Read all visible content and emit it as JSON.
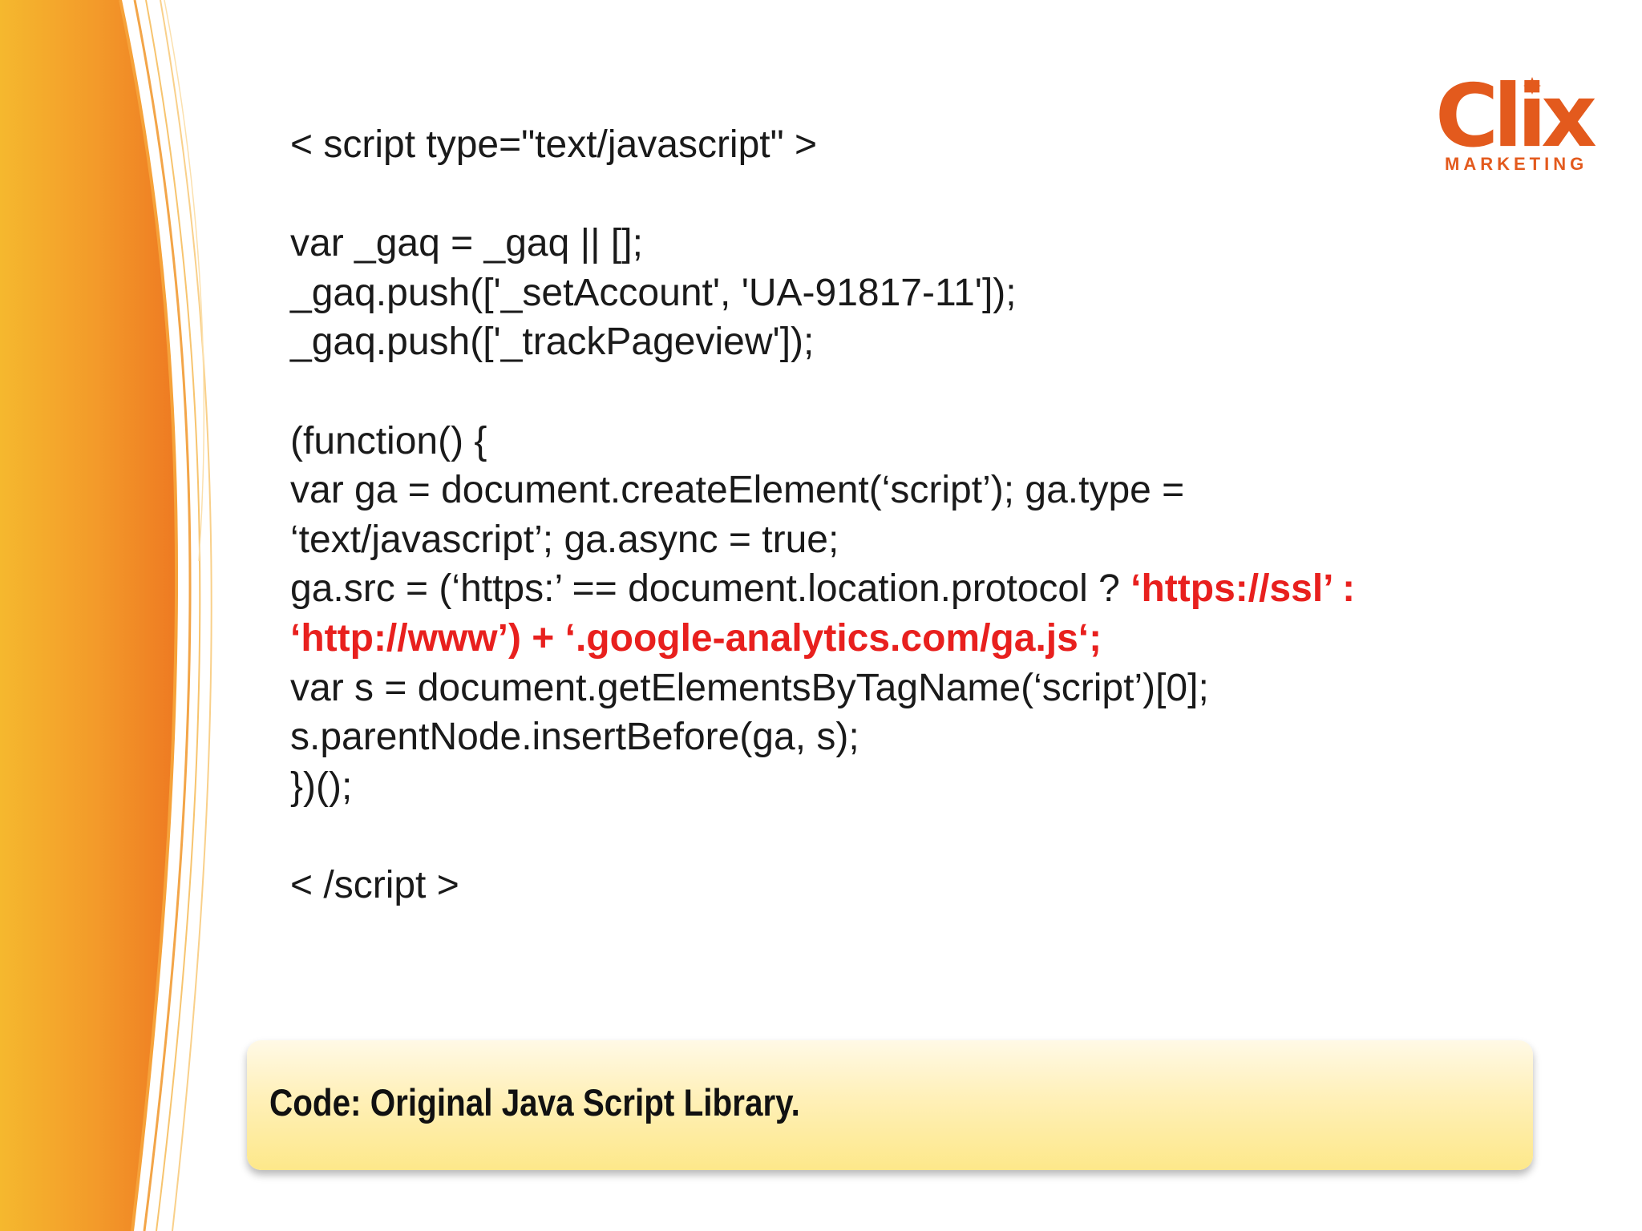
{
  "logo": {
    "word": "Clix",
    "sub": "MARKETING",
    "color": "#e35a1d"
  },
  "code": {
    "lines": [
      "< script type=\"text/javascript\" >",
      "",
      "var _gaq = _gaq || [];",
      "_gaq.push(['_setAccount', 'UA-91817-11']);",
      "_gaq.push(['_trackPageview']);",
      "",
      "(function() {",
      "var ga = document.createElement(‘script’); ga.type =",
      "‘text/javascript’; ga.async = true;",
      "ga.src = (‘https:’ == document.location.protocol ? ",
      "",
      "var s = document.getElementsByTagName(‘script’)[0];",
      "s.parentNode.insertBefore(ga, s);",
      "})();",
      "",
      "< /script >"
    ],
    "highlight_line_9": "‘https://ssl’ :",
    "highlight_line_10": "‘http://www’) + ‘.google-analytics.com/ga.js‘;",
    "highlight_color": "#e8201e"
  },
  "caption": {
    "text": "Code: Original Java Script Library."
  },
  "colors": {
    "accent_orange": "#f08a24",
    "accent_yellow": "#f5b82e",
    "caption_fill": "#fde88a"
  }
}
